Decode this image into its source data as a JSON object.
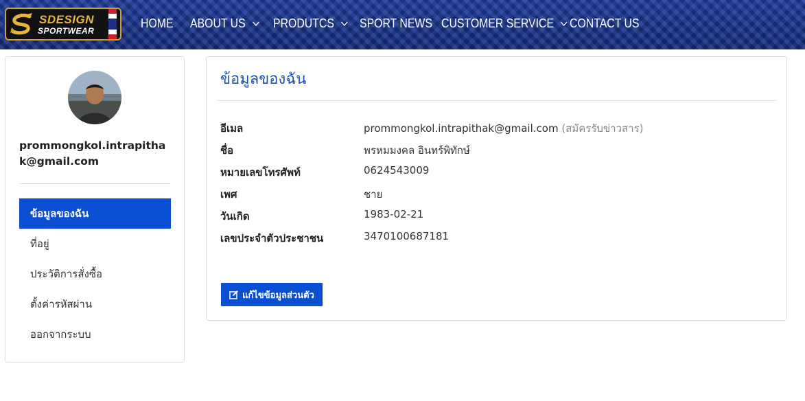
{
  "brand": {
    "line1": "SDESIGN",
    "line2": "SPORTWEAR",
    "logo_icon": "dragon-s-logo",
    "gold": "#c9a13b"
  },
  "nav": {
    "items": [
      {
        "label": "HOME",
        "dropdown": false
      },
      {
        "label": "ABOUT US",
        "dropdown": true
      },
      {
        "label": "PRODUTCS",
        "dropdown": true
      },
      {
        "label": "SPORT NEWS",
        "dropdown": false
      },
      {
        "label": "CUSTOMER SERVICE",
        "dropdown": true
      },
      {
        "label": "CONTACT US",
        "dropdown": false
      }
    ],
    "chevron_icon": "chevron-down-icon"
  },
  "sidebar": {
    "email": "prommongkol.intrapithak@gmail.com",
    "menu": [
      {
        "label": "ข้อมูลของฉัน",
        "active": true
      },
      {
        "label": "ที่อยู่",
        "active": false
      },
      {
        "label": "ประวัติการสั่งซื้อ",
        "active": false
      },
      {
        "label": "ตั้งค่ารหัสผ่าน",
        "active": false
      },
      {
        "label": "ออกจากระบบ",
        "active": false
      }
    ]
  },
  "profile": {
    "title": "ข้อมูลของฉัน",
    "rows": [
      {
        "label": "อีเมล",
        "value": "prommongkol.intrapithak@gmail.com",
        "note": "(สมัครรับข่าวสาร)"
      },
      {
        "label": "ชื่อ",
        "value": "พรหมมงคล อินทร์พิทักษ์",
        "note": ""
      },
      {
        "label": "หมายเลขโทรศัพท์",
        "value": "0624543009",
        "note": ""
      },
      {
        "label": "เพศ",
        "value": "ชาย",
        "note": ""
      },
      {
        "label": "วันเกิด",
        "value": "1983-02-21",
        "note": ""
      },
      {
        "label": "เลขประจำตัวประชาชน",
        "value": "3470100687181",
        "note": ""
      }
    ],
    "edit_button": "แก้ไขข้อมูลส่วนตัว",
    "edit_icon": "edit-icon"
  },
  "colors": {
    "accent": "#0a4fd1",
    "title": "#1c4fb8",
    "header": "#17328a"
  }
}
